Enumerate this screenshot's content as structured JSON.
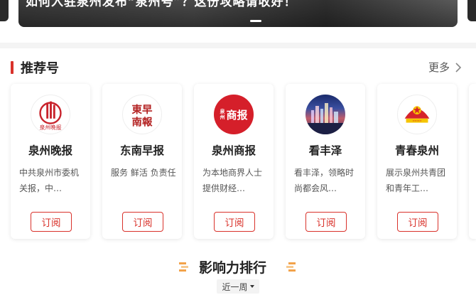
{
  "banner": {
    "title": "如何入驻泉州发布“泉州号”？这份攻略请收好！"
  },
  "recommend": {
    "title": "推荐号",
    "more_label": "更多"
  },
  "accounts": [
    {
      "name": "泉州晚报",
      "desc": "中共泉州市委机关报，中…",
      "subscribe_label": "订阅",
      "logo_text": "泉州晚报"
    },
    {
      "name": "东南早报",
      "desc": "服务 鲜活 负责任",
      "subscribe_label": "订阅",
      "logo_text": "東早南報"
    },
    {
      "name": "泉州商报",
      "desc": "为本地商界人士提供财经…",
      "subscribe_label": "订阅",
      "logo_text": "商报",
      "logo_small": "泉州"
    },
    {
      "name": "看丰泽",
      "desc": "看丰泽，领略时尚都会风…",
      "subscribe_label": "订阅"
    },
    {
      "name": "青春泉州",
      "desc": "展示泉州共青团和青年工…",
      "subscribe_label": "订阅"
    }
  ],
  "ranking": {
    "title": "影响力排行",
    "period_label": "近一周"
  },
  "colors": {
    "accent": "#d9322b",
    "rank_deco": "#f2a24a"
  }
}
